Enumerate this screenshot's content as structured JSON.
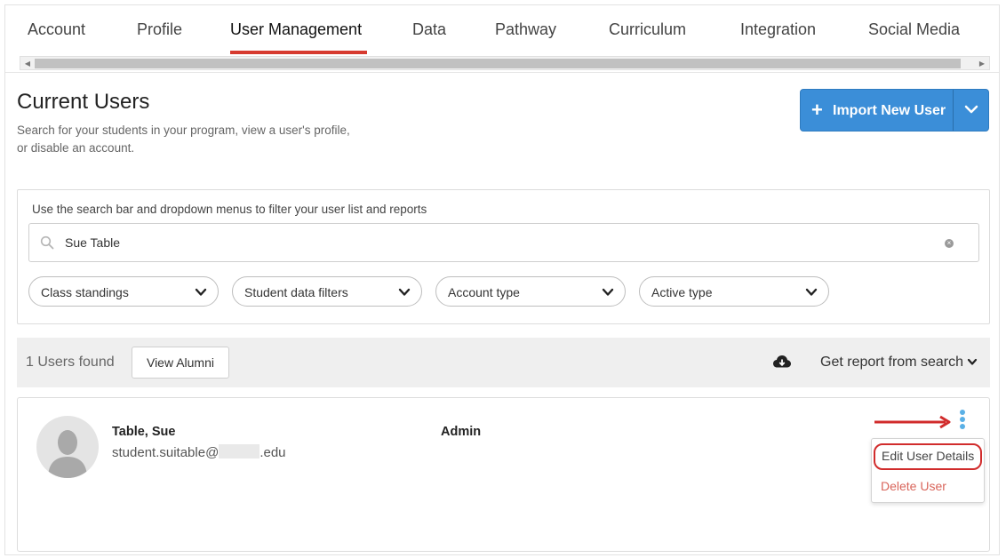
{
  "tabs": [
    {
      "label": "Account"
    },
    {
      "label": "Profile"
    },
    {
      "label": "User Management"
    },
    {
      "label": "Data"
    },
    {
      "label": "Pathway"
    },
    {
      "label": "Curriculum"
    },
    {
      "label": "Integration"
    },
    {
      "label": "Social Media"
    }
  ],
  "active_tab": "User Management",
  "header": {
    "title": "Current Users",
    "description": "Search for your students in your program, view a user's profile, or disable an account."
  },
  "import_button": {
    "label": "Import New User",
    "plus": "+"
  },
  "filters": {
    "hint": "Use the search bar and dropdown menus to filter your user list and reports",
    "search_value": "Sue Table",
    "dropdowns": [
      {
        "label": "Class standings"
      },
      {
        "label": "Student data filters"
      },
      {
        "label": "Account type"
      },
      {
        "label": "Active type"
      }
    ]
  },
  "results": {
    "count_text": "1 Users found",
    "view_alumni": "View Alumni",
    "report": "Get report from search"
  },
  "user": {
    "name": "Table, Sue",
    "email_prefix": "student.suitable@",
    "email_suffix": ".edu",
    "role": "Admin"
  },
  "menu": {
    "edit": "Edit User Details",
    "delete": "Delete User"
  },
  "colors": {
    "accent_red": "#d63a2f",
    "primary_blue": "#3b8ed8",
    "kebab_blue": "#5ab0e6"
  }
}
